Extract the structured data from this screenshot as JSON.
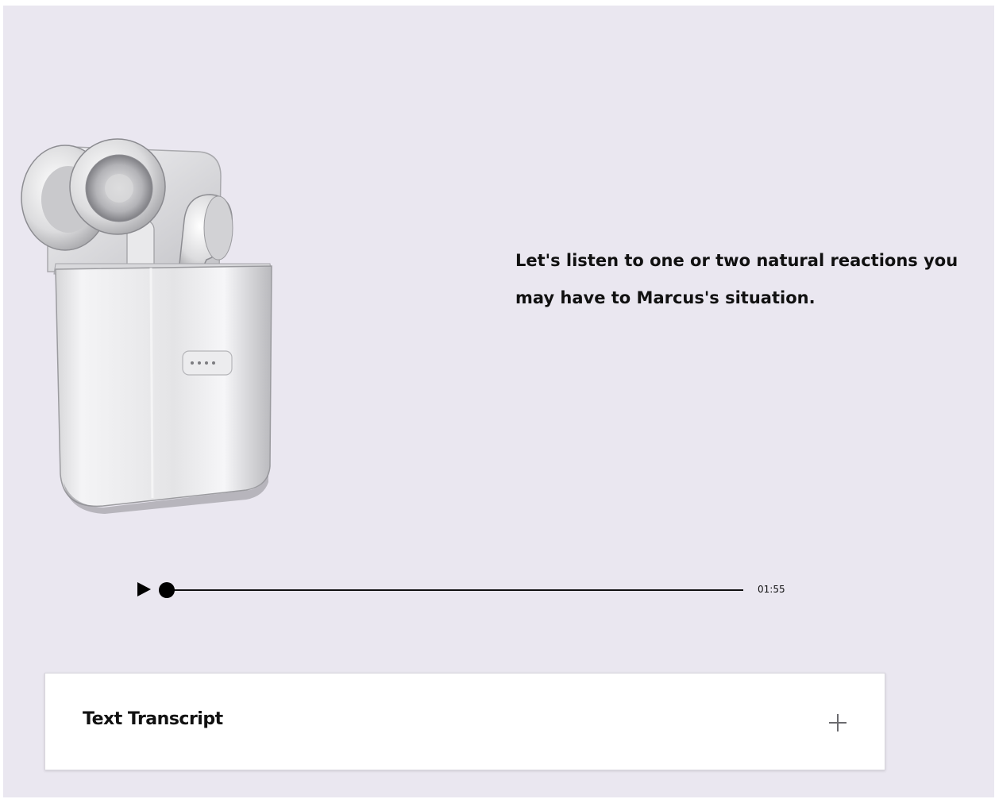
{
  "page": {
    "background": "#eae7f0",
    "text_color": "#111111"
  },
  "illustration": {
    "icon": "wireless-earbuds-case-image"
  },
  "content": {
    "prompt": "Let's listen to one or two natural reactions you may have to Marcus's situation."
  },
  "audio_player": {
    "play_icon": "play-icon",
    "duration": "01:55",
    "progress": 0
  },
  "transcript": {
    "title": "Text Transcript",
    "expand_icon": "plus-icon"
  }
}
